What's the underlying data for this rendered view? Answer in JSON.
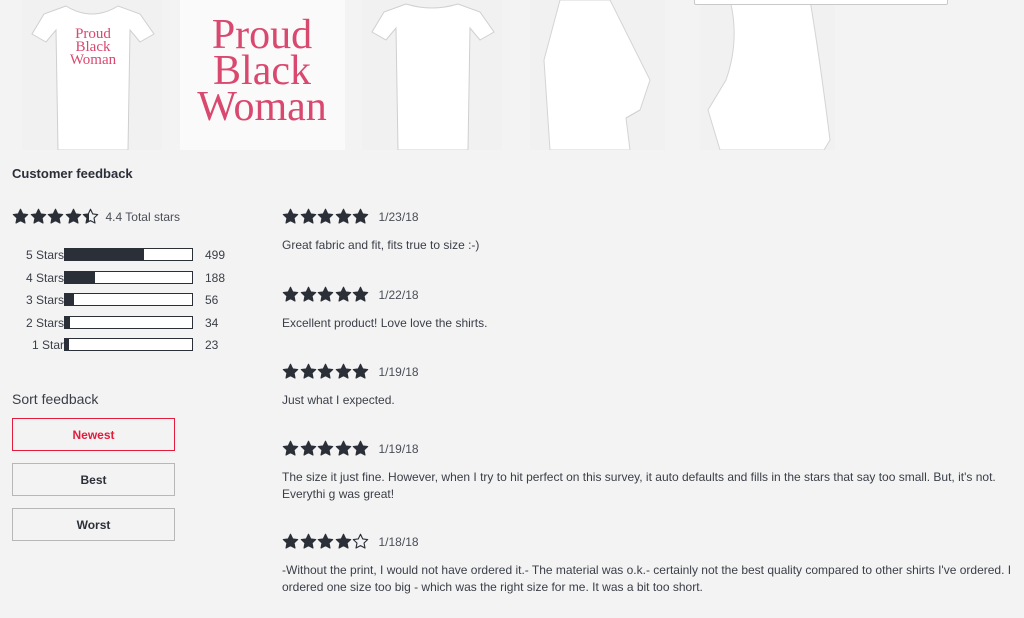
{
  "product": {
    "print_lines": [
      "Proud",
      "Black",
      "Woman"
    ]
  },
  "feedback": {
    "title": "Customer feedback",
    "average_rating": 4.4,
    "total_label": "4.4 Total stars",
    "distribution": [
      {
        "label": "5 Stars",
        "count": "499",
        "fraction": 0.62
      },
      {
        "label": "4 Stars",
        "count": "188",
        "fraction": 0.24
      },
      {
        "label": "3 Stars",
        "count": "56",
        "fraction": 0.07
      },
      {
        "label": "2 Stars",
        "count": "34",
        "fraction": 0.04
      },
      {
        "label": "1 Star",
        "count": "23",
        "fraction": 0.03
      }
    ]
  },
  "sort": {
    "title": "Sort feedback",
    "options": [
      {
        "label": "Newest",
        "active": true
      },
      {
        "label": "Best",
        "active": false
      },
      {
        "label": "Worst",
        "active": false
      }
    ]
  },
  "reviews": [
    {
      "rating": 5,
      "date": "1/23/18",
      "text": "Great fabric and fit, fits true to size :-)"
    },
    {
      "rating": 5,
      "date": "1/22/18",
      "text": "Excellent product! Love love the shirts."
    },
    {
      "rating": 5,
      "date": "1/19/18",
      "text": "Just what I expected."
    },
    {
      "rating": 5,
      "date": "1/19/18",
      "text": "The size it just fine. However, when I try to hit perfect on this survey, it auto defaults and fills in the stars that say too small. But, it's not. Everythi g was great!"
    },
    {
      "rating": 4,
      "date": "1/18/18",
      "text": "-Without the print, I would not have ordered it.- The material was o.k.- certainly not the best quality compared to other shirts I've ordered. I ordered one size too big - which was the right size for me. It was a bit too short."
    }
  ],
  "colors": {
    "star": "#2b2f38",
    "accent": "#e31c3d",
    "print": "#d9486e"
  }
}
